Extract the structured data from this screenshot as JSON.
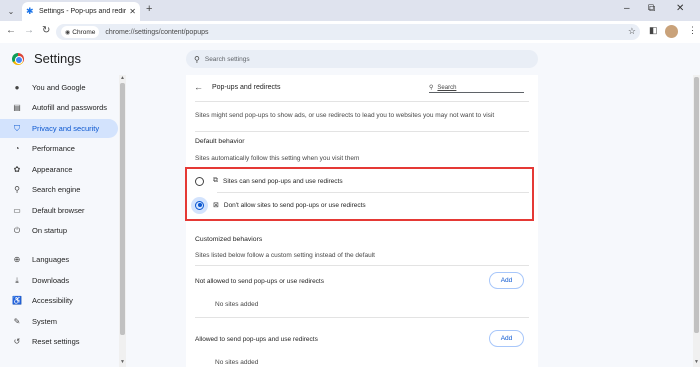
{
  "browser": {
    "tab_title": "Settings - Pop-ups and redirect",
    "tab_close": "✕",
    "new_tab": "+",
    "window_controls": {
      "minimize": "–",
      "restore": "⧉",
      "close": "✕"
    },
    "chip_label": "Chrome",
    "url": "chrome://settings/content/popups"
  },
  "header": {
    "app_title": "Settings",
    "search_placeholder": "Search settings"
  },
  "sidebar": {
    "items": [
      {
        "label": "You and Google",
        "icon": "person-icon",
        "active": false
      },
      {
        "label": "Autofill and passwords",
        "icon": "clipboard-icon",
        "active": false
      },
      {
        "label": "Privacy and security",
        "icon": "shield-icon",
        "active": true
      },
      {
        "label": "Performance",
        "icon": "speedometer-icon",
        "active": false
      },
      {
        "label": "Appearance",
        "icon": "palette-icon",
        "active": false
      },
      {
        "label": "Search engine",
        "icon": "search-icon",
        "active": false
      },
      {
        "label": "Default browser",
        "icon": "browser-icon",
        "active": false
      },
      {
        "label": "On startup",
        "icon": "power-icon",
        "active": false
      },
      {
        "label": "Languages",
        "icon": "globe-icon",
        "active": false
      },
      {
        "label": "Downloads",
        "icon": "download-icon",
        "active": false
      },
      {
        "label": "Accessibility",
        "icon": "accessibility-icon",
        "active": false
      },
      {
        "label": "System",
        "icon": "wrench-icon",
        "active": false
      },
      {
        "label": "Reset settings",
        "icon": "reset-icon",
        "active": false
      }
    ]
  },
  "content": {
    "title": "Pop-ups and redirects",
    "search_placeholder": "Search",
    "description": "Sites might send pop-ups to show ads, or use redirects to lead you to websites you may not want to visit",
    "default_behavior": {
      "title": "Default behavior",
      "subtitle": "Sites automatically follow this setting when you visit them",
      "options": [
        {
          "label": "Sites can send pop-ups and use redirects",
          "selected": false
        },
        {
          "label": "Don't allow sites to send pop-ups or use redirects",
          "selected": true
        }
      ]
    },
    "customized": {
      "title": "Customized behaviors",
      "subtitle": "Sites listed below follow a custom setting instead of the default",
      "blocked_label": "Not allowed to send pop-ups or use redirects",
      "blocked_empty": "No sites added",
      "allowed_label": "Allowed to send pop-ups and use redirects",
      "allowed_empty": "No sites added",
      "add_label": "Add"
    }
  },
  "colors": {
    "accent": "#0b57d0",
    "active_nav_bg": "#d3e3fd",
    "highlight_border": "#e53935"
  }
}
